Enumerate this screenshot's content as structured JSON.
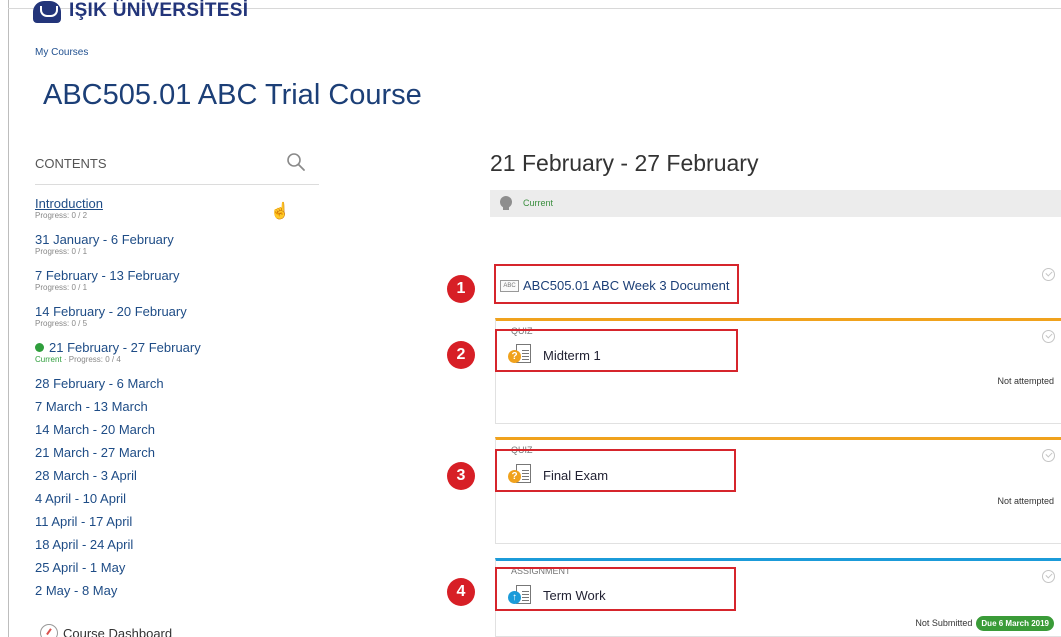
{
  "header": {
    "university_name": "IŞIK ÜNİVERSİTESİ",
    "breadcrumb": "My Courses",
    "course_title": "ABC505.01 ABC Trial Course"
  },
  "sidebar": {
    "heading": "CONTENTS",
    "items": [
      {
        "label": "Introduction",
        "sub": "Progress: 0 / 2"
      },
      {
        "label": "31 January - 6 February",
        "sub": "Progress: 0 / 1"
      },
      {
        "label": "7 February - 13 February",
        "sub": "Progress: 0 / 1"
      },
      {
        "label": "14 February - 20 February",
        "sub": "Progress: 0 / 5"
      },
      {
        "label": "21 February - 27 February",
        "sub_current": "Current",
        "sub_sep": " · ",
        "sub": "Progress: 0 / 4"
      },
      {
        "label": "28 February - 6 March"
      },
      {
        "label": "7 March - 13 March"
      },
      {
        "label": "14 March - 20 March"
      },
      {
        "label": "21 March - 27 March"
      },
      {
        "label": "28 March - 3 April"
      },
      {
        "label": "4 April - 10 April"
      },
      {
        "label": "11 April - 17 April"
      },
      {
        "label": "18 April - 24 April"
      },
      {
        "label": "25 April - 1 May"
      },
      {
        "label": "2 May - 8 May"
      }
    ],
    "dashboard_link": "Course Dashboard"
  },
  "section": {
    "title": "21 February - 27 February",
    "current_label": "Current",
    "activities": [
      {
        "type": "",
        "name": "ABC505.01 ABC Week 3 Document",
        "status": "",
        "icon_text": "ABC"
      },
      {
        "type": "QUIZ",
        "name": "Midterm 1",
        "status": "Not attempted"
      },
      {
        "type": "QUIZ",
        "name": "Final Exam",
        "status": "Not attempted"
      },
      {
        "type": "ASSIGNMENT",
        "name": "Term Work",
        "status": "Not Submitted",
        "due": "Due 6 March 2019"
      }
    ]
  },
  "annotations": [
    "1",
    "2",
    "3",
    "4"
  ],
  "colors": {
    "brand": "#23357a",
    "link": "#1c3f77",
    "quiz_accent": "#f0a21d",
    "assignment_accent": "#1b9bd9",
    "current_green": "#2f9e3c",
    "highlight_red": "#d6252c"
  }
}
